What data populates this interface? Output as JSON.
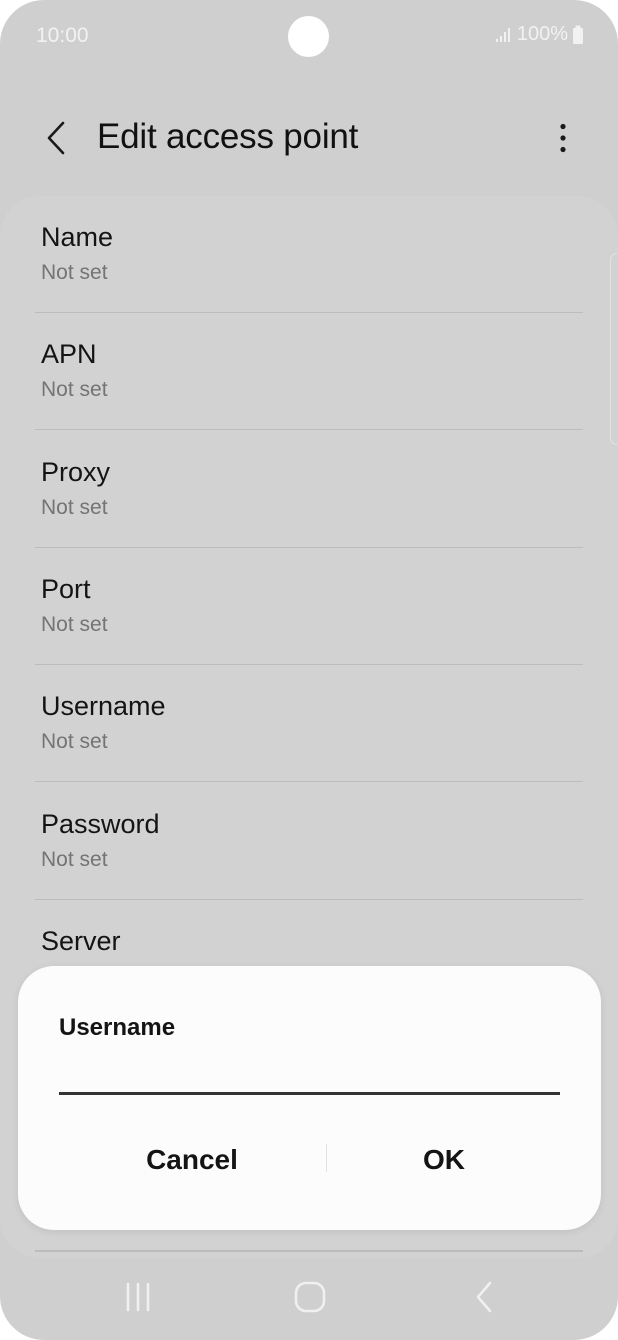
{
  "status_bar": {
    "time": "10:00",
    "battery": "100%"
  },
  "header": {
    "title": "Edit access point",
    "back_icon": "chevron-left-icon",
    "more_icon": "more-vertical-icon"
  },
  "settings": [
    {
      "label": "Name",
      "value": "Not set"
    },
    {
      "label": "APN",
      "value": "Not set"
    },
    {
      "label": "Proxy",
      "value": "Not set"
    },
    {
      "label": "Port",
      "value": "Not set"
    },
    {
      "label": "Username",
      "value": "Not set"
    },
    {
      "label": "Password",
      "value": "Not set"
    },
    {
      "label": "Server",
      "value": ""
    }
  ],
  "dialog": {
    "title": "Username",
    "input_value": "",
    "cancel_label": "Cancel",
    "ok_label": "OK"
  },
  "nav_bar": {
    "recents_icon": "recent-apps-icon",
    "home_icon": "home-icon",
    "back_icon": "back-icon"
  },
  "colors": {
    "background": "#cfcfcf",
    "dialog_bg": "#fcfcfc",
    "text_primary": "#141414",
    "text_secondary": "#747474"
  }
}
